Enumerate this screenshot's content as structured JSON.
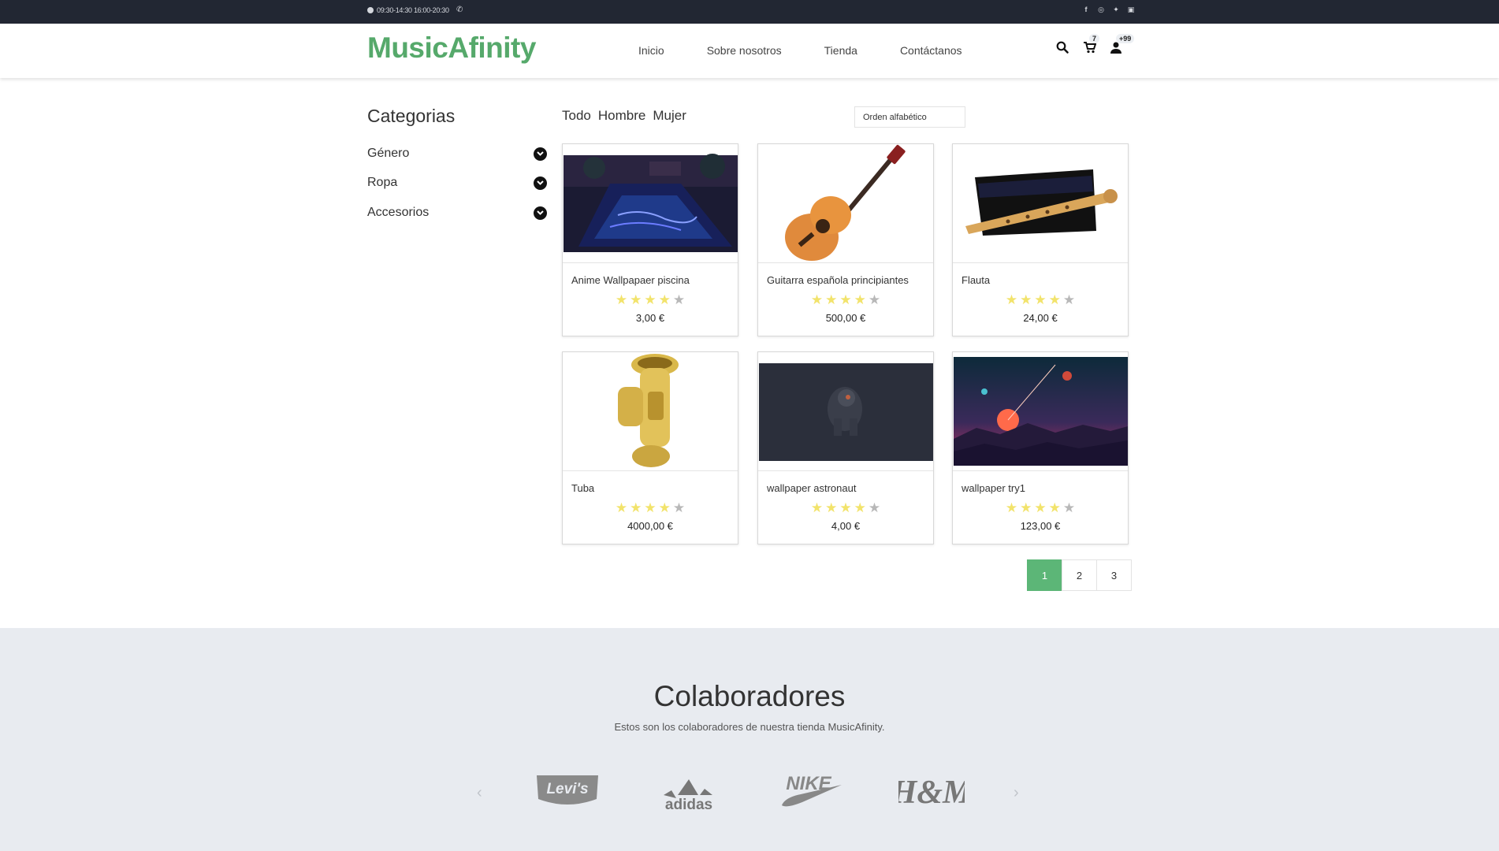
{
  "topbar": {
    "hours": "09:30-14:30 16:00-20:30",
    "phone_icon": "phone-icon",
    "social": [
      {
        "icon": "facebook-icon",
        "glyph": "f"
      },
      {
        "icon": "instagram-icon",
        "glyph": "◎"
      },
      {
        "icon": "twitter-icon",
        "glyph": "✦"
      },
      {
        "icon": "linkedin-icon",
        "glyph": "▣"
      }
    ]
  },
  "header": {
    "logo": "MusicAfinity",
    "nav": [
      "Inicio",
      "Sobre nosotros",
      "Tienda",
      "Contáctanos"
    ],
    "cart_count": "7",
    "user_count": "+99"
  },
  "sidebar": {
    "title": "Categorias",
    "items": [
      "Género",
      "Ropa",
      "Accesorios"
    ]
  },
  "filters": {
    "tabs": [
      "Todo",
      "Hombre",
      "Mujer"
    ],
    "sort_value": "Orden alfabético"
  },
  "products": [
    {
      "name": "Anime Wallpapaer piscina",
      "rating": 4,
      "price": "3,00 €",
      "image": "pool-wallpaper"
    },
    {
      "name": "Guitarra española principiantes",
      "rating": 4,
      "price": "500,00 €",
      "image": "guitar"
    },
    {
      "name": "Flauta",
      "rating": 4,
      "price": "24,00 €",
      "image": "recorder-flute"
    },
    {
      "name": "Tuba",
      "rating": 4,
      "price": "4000,00 €",
      "image": "tuba"
    },
    {
      "name": "wallpaper astronaut",
      "rating": 4,
      "price": "4,00 €",
      "image": "astronaut-wallpaper"
    },
    {
      "name": "wallpaper try1",
      "rating": 4,
      "price": "123,00 €",
      "image": "space-sunset-wallpaper"
    }
  ],
  "pagination": {
    "pages": [
      "1",
      "2",
      "3"
    ],
    "active": "1"
  },
  "colors": {
    "brand_green": "#56a96b",
    "active_page": "#5cb677",
    "star": "#f2e36b",
    "dark_bar": "#222733",
    "footer_bg": "#e8ebf0"
  },
  "collaborators": {
    "title": "Colaboradores",
    "subtitle": "Estos son los colaboradores de nuestra tienda MusicAfinity.",
    "brands": [
      "Levi's",
      "adidas",
      "NIKE",
      "H&M"
    ]
  }
}
